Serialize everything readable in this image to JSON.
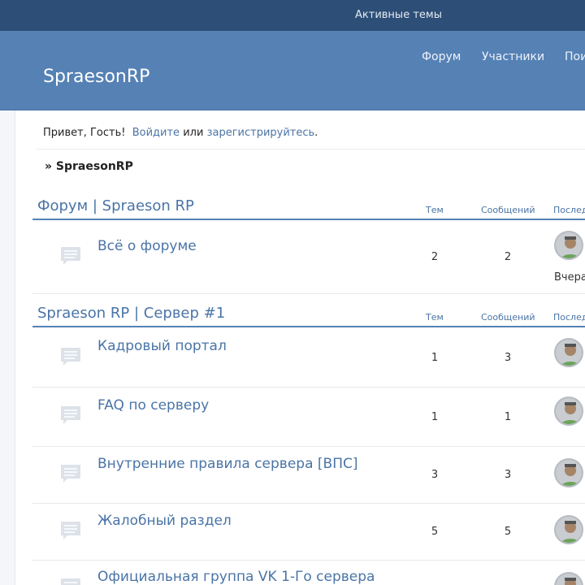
{
  "topbar": {
    "active_topics": "Активные темы"
  },
  "header": {
    "logo": "SpraesonRP",
    "nav": [
      "Форум",
      "Участники",
      "Поиск"
    ]
  },
  "greeting": {
    "prefix": "Привет, Гость!",
    "login": "Войдите",
    "or": "или",
    "register": "зарегистрируйтесь",
    "suffix": "."
  },
  "breadcrumb": {
    "arrow": "»",
    "label": "SpraesonRP"
  },
  "categories": [
    {
      "title": "Форум | Spraeson RP",
      "col_topics": "Тем",
      "col_posts": "Сообщений",
      "col_last": "Последнее",
      "forums": [
        {
          "name": "Всё о форуме",
          "topics": "2",
          "posts": "2",
          "last": "Вчера"
        }
      ]
    },
    {
      "title": "Spraeson RP | Сервер #1",
      "col_topics": "Тем",
      "col_posts": "Сообщений",
      "col_last": "Последнее",
      "forums": [
        {
          "name": "Кадровый портал",
          "topics": "1",
          "posts": "3"
        },
        {
          "name": "FAQ по серверу",
          "topics": "1",
          "posts": "1"
        },
        {
          "name": "Внутренние правила сервера [ВПС]",
          "topics": "3",
          "posts": "3"
        },
        {
          "name": "Жалобный раздел",
          "topics": "5",
          "posts": "5"
        },
        {
          "name": "Официальная группа VK 1-Го сервера",
          "topics": "",
          "posts": ""
        }
      ]
    }
  ],
  "icons": {
    "forum": "chat-bubble-icon",
    "avatar": "user-avatar"
  },
  "colors": {
    "topbar": "#2d4e76",
    "header": "#5581b5",
    "link": "#4a74a6"
  }
}
